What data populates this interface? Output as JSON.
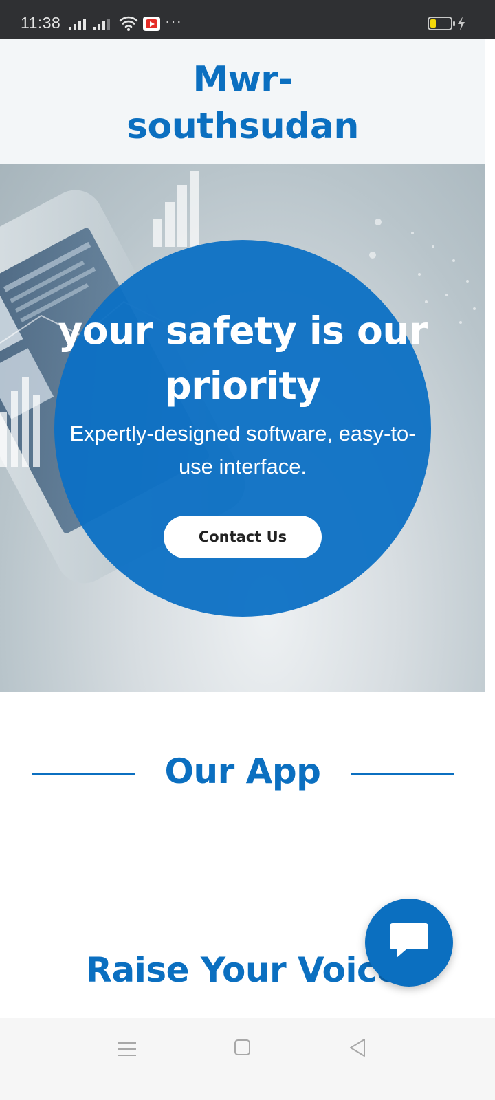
{
  "status_bar": {
    "time": "11:38",
    "more": "···",
    "icons": [
      "signal-icon",
      "signal-icon",
      "wifi-icon",
      "youtube-icon",
      "battery-icon",
      "charging-icon"
    ]
  },
  "header": {
    "site_title": "Mwr-\nsouthsudan"
  },
  "hero": {
    "title": "your safety is our priority",
    "subtitle": "Expertly-designed software, easy-to-use interface.",
    "cta_label": "Contact Us"
  },
  "sections": {
    "app_heading": "Our App",
    "voice_heading": "Raise Your Voice"
  },
  "chat": {
    "icon": "chat-bubble-icon"
  },
  "nav_bar": {
    "icons": [
      "menu-icon",
      "home-icon",
      "back-icon"
    ]
  },
  "colors": {
    "brand_blue": "#0b6fc0",
    "status_bar": "#2f3033",
    "header_bg": "#f3f6f8"
  }
}
